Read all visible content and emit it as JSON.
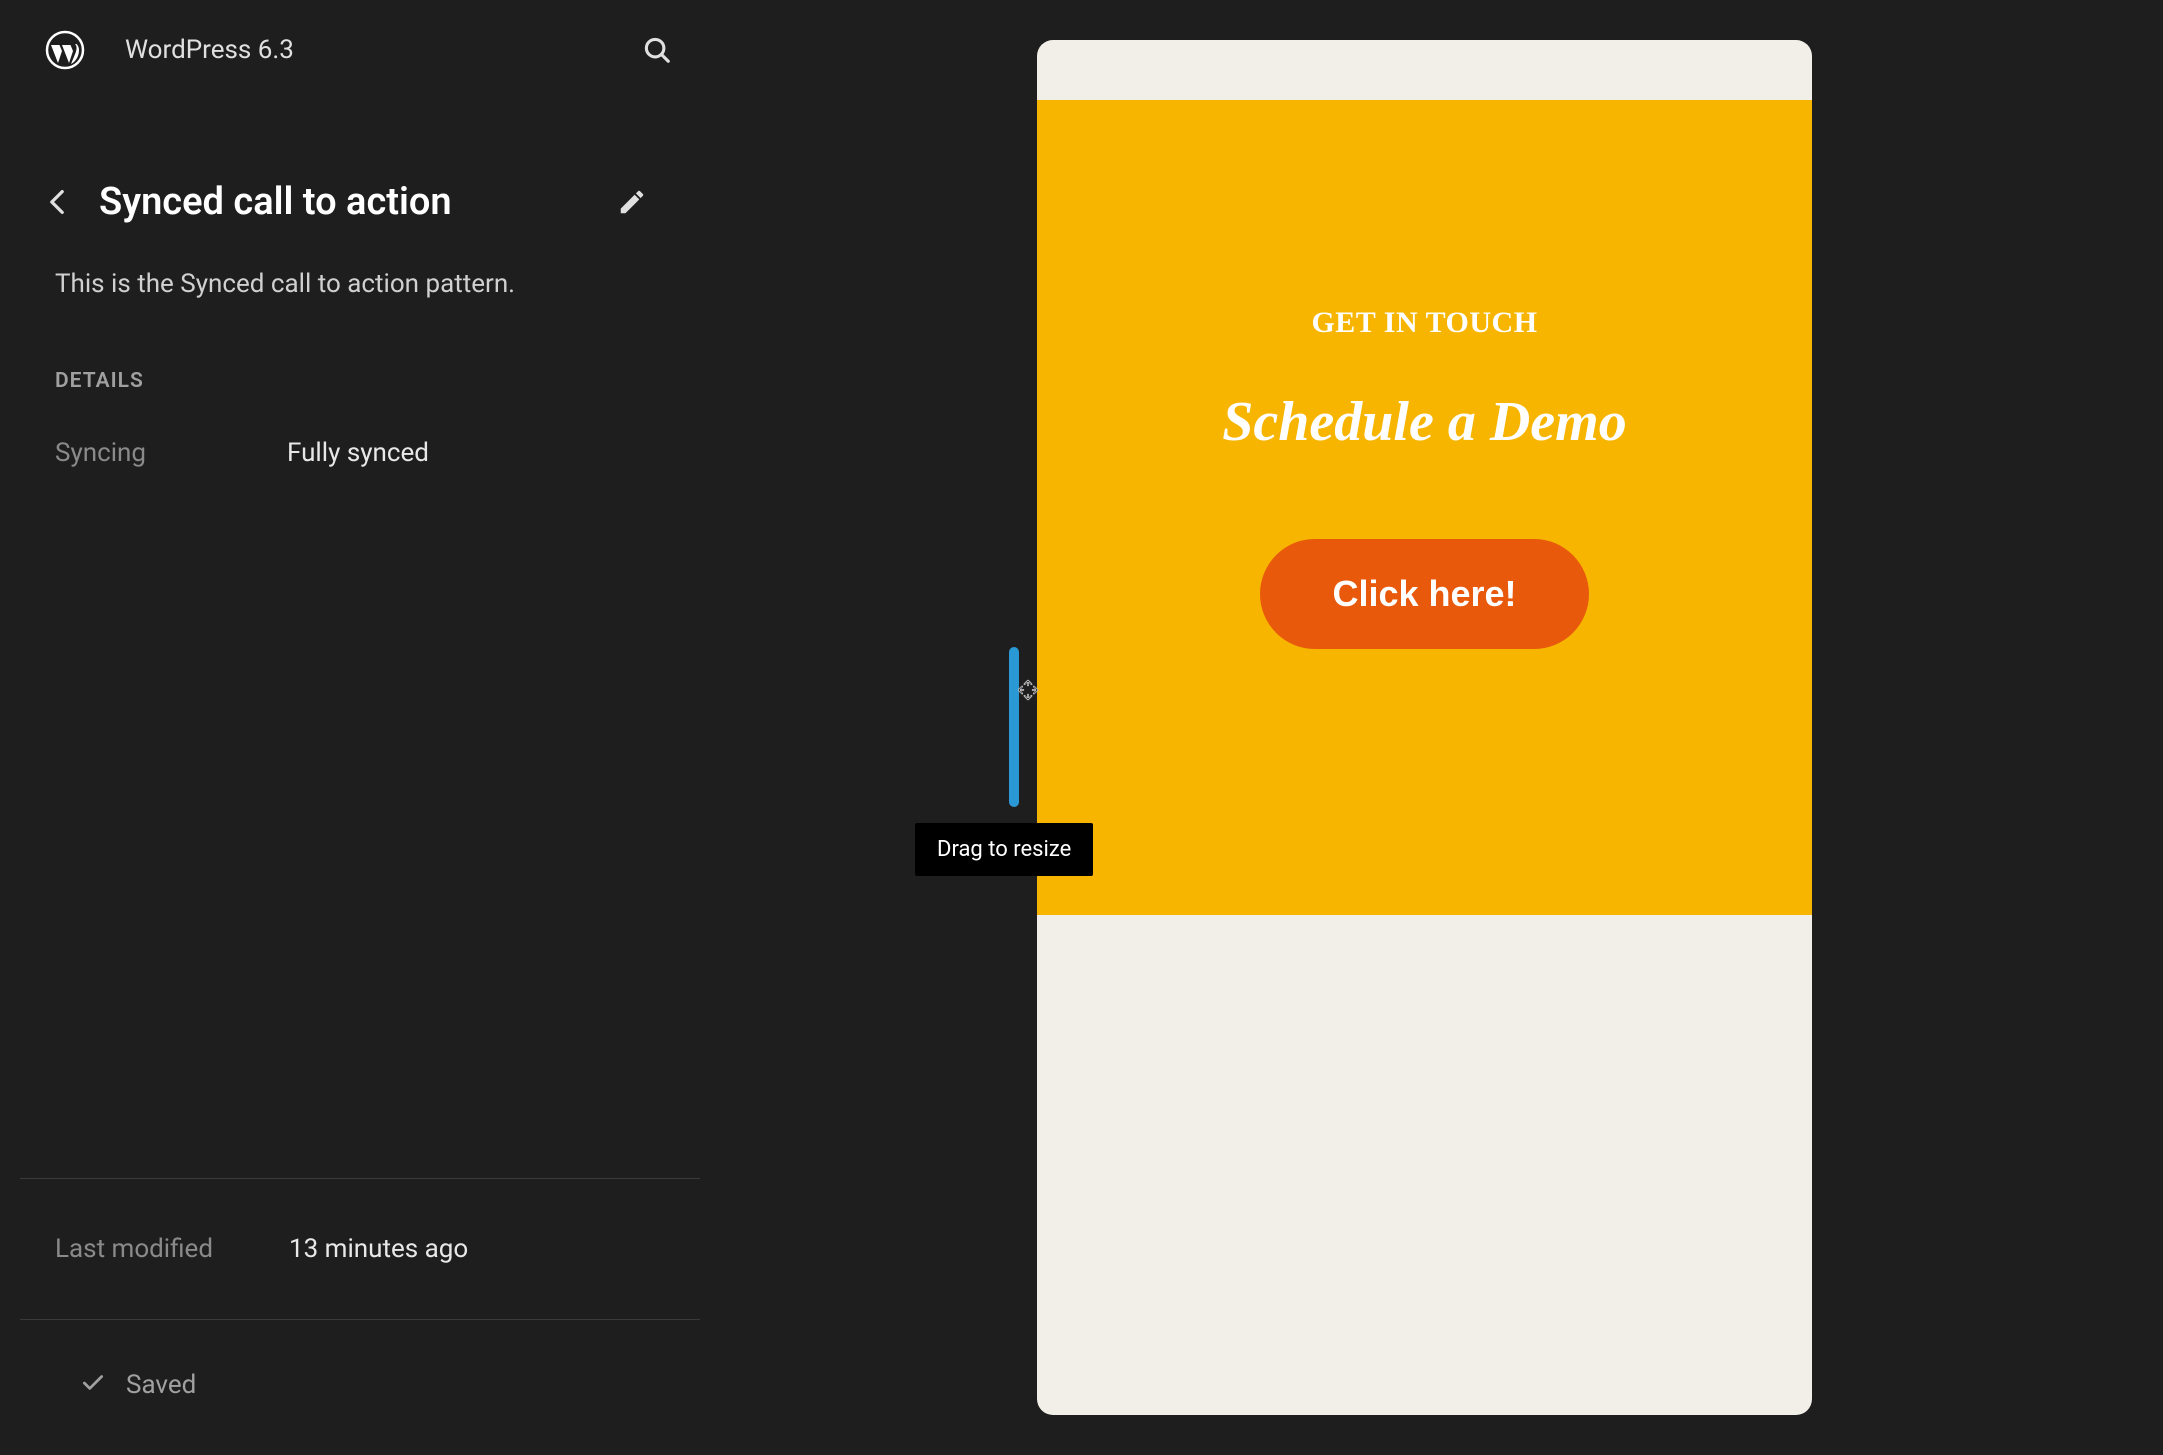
{
  "header": {
    "version": "WordPress 6.3"
  },
  "sidebar": {
    "title": "Synced call to action",
    "description": "This is the Synced call to action pattern.",
    "details_label": "DETAILS",
    "syncing_key": "Syncing",
    "syncing_value": "Fully synced",
    "last_modified_key": "Last modified",
    "last_modified_value": "13 minutes ago",
    "saved_label": "Saved"
  },
  "preview": {
    "eyebrow": "GET IN TOUCH",
    "heading": "Schedule a Demo",
    "button_label": "Click here!"
  },
  "tooltip": {
    "resize": "Drag to resize"
  },
  "colors": {
    "bg": "#1e1e1e",
    "cta_bg": "#f7b500",
    "cta_button": "#e8590c",
    "canvas_bg": "#f2efe8",
    "handle": "#2a98d4"
  }
}
